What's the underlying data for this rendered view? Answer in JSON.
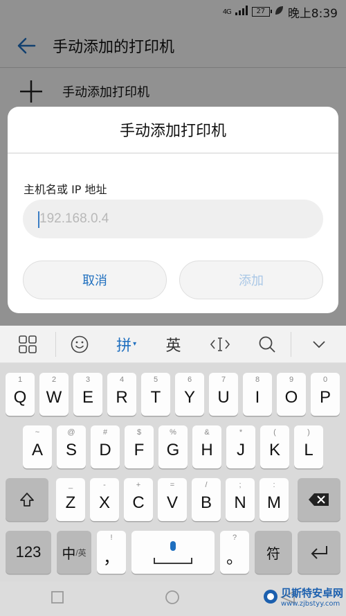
{
  "status": {
    "network": "4G",
    "battery": "27",
    "time": "晚上8:39"
  },
  "header": {
    "title": "手动添加的打印机"
  },
  "list": {
    "add_label": "手动添加打印机"
  },
  "dialog": {
    "title": "手动添加打印机",
    "host_label": "主机名或 IP 地址",
    "ip_placeholder": "192.168.0.4",
    "cancel_label": "取消",
    "add_label": "添加"
  },
  "kb_toolbar": {
    "pinyin": "拼",
    "english": "英"
  },
  "keyboard": {
    "row1": [
      [
        "Q",
        "1"
      ],
      [
        "W",
        "2"
      ],
      [
        "E",
        "3"
      ],
      [
        "R",
        "4"
      ],
      [
        "T",
        "5"
      ],
      [
        "Y",
        "6"
      ],
      [
        "U",
        "7"
      ],
      [
        "I",
        "8"
      ],
      [
        "O",
        "9"
      ],
      [
        "P",
        "0"
      ]
    ],
    "row2": [
      [
        "A",
        "~"
      ],
      [
        "S",
        "@"
      ],
      [
        "D",
        "#"
      ],
      [
        "F",
        "$"
      ],
      [
        "G",
        "%"
      ],
      [
        "H",
        "&"
      ],
      [
        "J",
        "*"
      ],
      [
        "K",
        "("
      ],
      [
        "L",
        ")"
      ]
    ],
    "row3": [
      [
        "Z",
        "_"
      ],
      [
        "X",
        "-"
      ],
      [
        "C",
        "+"
      ],
      [
        "V",
        "="
      ],
      [
        "B",
        "/"
      ],
      [
        "N",
        ";"
      ],
      [
        "M",
        ":"
      ]
    ],
    "num_label": "123",
    "zh_label": "中",
    "zh_sub": "/英",
    "comma_label": "，",
    "comma_sub": "!",
    "period_label": "。",
    "period_sub": "?",
    "symbol_label": "符"
  },
  "watermark": {
    "brand": "贝斯特安卓网",
    "url": "www.zjbstyy.com"
  }
}
